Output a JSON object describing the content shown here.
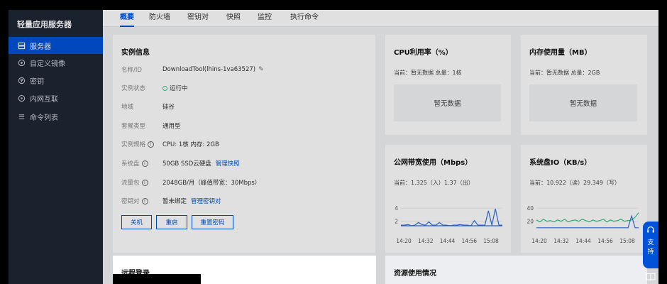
{
  "sidebar": {
    "title": "轻量应用服务器",
    "items": [
      {
        "label": "服务器",
        "icon": "server-icon"
      },
      {
        "label": "自定义镜像",
        "icon": "image-icon"
      },
      {
        "label": "密钥",
        "icon": "key-icon"
      },
      {
        "label": "内网互联",
        "icon": "network-icon"
      },
      {
        "label": "命令列表",
        "icon": "list-icon"
      }
    ]
  },
  "tabs": [
    "概要",
    "防火墙",
    "密钥对",
    "快照",
    "监控",
    "执行命令"
  ],
  "instance": {
    "title": "实例信息",
    "rows": [
      {
        "label": "名称/ID",
        "value": "DownloadTool(lhins-1va63527)"
      },
      {
        "label": "实例状态",
        "value": "运行中"
      },
      {
        "label": "地域",
        "value": "硅谷"
      },
      {
        "label": "套餐类型",
        "value": "通用型"
      },
      {
        "label": "实例规格",
        "value": "CPU: 1核 内存: 2GB"
      },
      {
        "label": "系统盘",
        "value": "50GB SSD云硬盘",
        "link": "管理快照"
      },
      {
        "label": "流量包",
        "value": "2048GB/月（峰值带宽：30Mbps）"
      },
      {
        "label": "密钥对",
        "value": "暂未绑定",
        "link": "管理密钥对"
      }
    ],
    "buttons": [
      "关机",
      "重启",
      "重置密码"
    ]
  },
  "cpu": {
    "title": "CPU利用率（%）",
    "sub": "当前：暂无数据 总量：1核",
    "nodata": "暂无数据"
  },
  "mem": {
    "title": "内存使用量（MB）",
    "sub": "当前：暂无数据 总量：2GB",
    "nodata": "暂无数据"
  },
  "net": {
    "title": "公网带宽使用（Mbps）",
    "sub": "当前：1.325（入）1.37（出）"
  },
  "disk": {
    "title": "系统盘IO（KB/s）",
    "sub": "当前：10.922（读）29.349（写）"
  },
  "remote": {
    "title": "远程登录"
  },
  "resource": {
    "title": "资源使用情况"
  },
  "float_help": {
    "label1": "支",
    "label2": "持"
  },
  "chart_data": [
    {
      "type": "line",
      "title": "公网带宽使用（Mbps）",
      "categories": [
        "14:20",
        "14:32",
        "14:44",
        "14:56",
        "15:08"
      ],
      "yticks": [
        2,
        4
      ],
      "ylim": [
        0,
        5
      ],
      "series": [
        {
          "color": "#2f6ee0",
          "values": [
            1.4,
            1.4,
            1.5,
            1.3,
            1.4,
            1.8,
            1.5,
            1.4,
            1.9,
            1.4,
            1.4,
            1.8,
            1.4,
            1.4,
            1.3,
            1.4,
            1.4,
            1.5,
            1.4,
            1.4,
            1.3,
            2.1,
            1.4,
            1.4,
            1.4,
            3.6,
            1.4,
            3.9,
            1.4,
            1.4
          ]
        },
        {
          "color": "#2f6ee0",
          "values": [
            1.3,
            1.3,
            1.3,
            1.3,
            1.3,
            1.3,
            1.3,
            1.3,
            1.3,
            1.3,
            1.3,
            1.3,
            1.3,
            1.3,
            1.3,
            1.3,
            1.3,
            1.3,
            1.3,
            1.3,
            1.3,
            1.3,
            1.3,
            1.3,
            1.3,
            1.3,
            1.3,
            1.3,
            1.3,
            1.3
          ]
        }
      ]
    },
    {
      "type": "line",
      "title": "系统盘IO（KB/s）",
      "categories": [
        "14:20",
        "14:32",
        "14:44",
        "14:56",
        "15:08"
      ],
      "yticks": [
        20,
        40
      ],
      "ylim": [
        0,
        50
      ],
      "series": [
        {
          "color": "#29cc85",
          "values": [
            22,
            19,
            23,
            20,
            21,
            19,
            22,
            20,
            23,
            19,
            21,
            22,
            20,
            23,
            21,
            19,
            22,
            20,
            21,
            23,
            19,
            22,
            20,
            21,
            23,
            20,
            21,
            22,
            26,
            33
          ]
        },
        {
          "color": "#2f6ee0",
          "values": [
            10,
            10,
            10,
            10,
            10,
            10,
            10,
            10,
            10,
            10,
            10,
            10,
            10,
            10,
            10,
            10,
            10,
            10,
            10,
            10,
            10,
            10,
            10,
            10,
            10,
            10,
            10,
            28,
            10,
            10
          ]
        }
      ]
    }
  ]
}
